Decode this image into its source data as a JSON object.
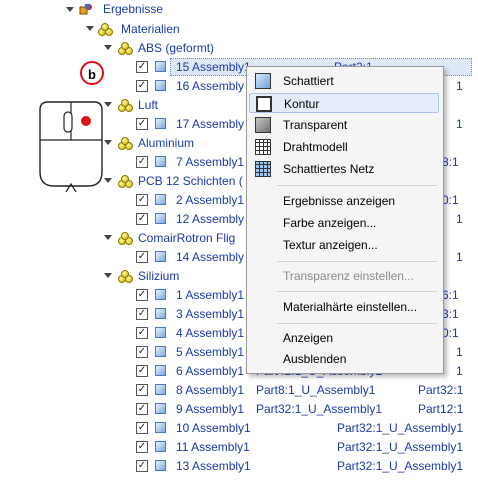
{
  "tree": {
    "root": "Ergebnisse",
    "materials": "Materialien",
    "groups": {
      "abs": "ABS (geformt)",
      "luft": "Luft",
      "aluminium": "Aluminium",
      "pcb": "PCB 12 Schichten (",
      "comair": "ComairRotron Flig",
      "silizium": "Silizium"
    },
    "rows": [
      {
        "name": "15 Assembly1",
        "c2": "",
        "c3": "Part2:1"
      },
      {
        "name": "16 Assembly",
        "c2": "",
        "c3": "1"
      },
      {
        "name": "17 Assembly",
        "c2": "",
        "c3": "1"
      },
      {
        "name": "7 Assembly1",
        "c2": "",
        "c3": "8:1"
      },
      {
        "name": "2 Assembly1",
        "c2": "",
        "c3": "0:1"
      },
      {
        "name": "12 Assembly",
        "c2": "",
        "c3": "1"
      },
      {
        "name": "14 Assembly",
        "c2": "",
        "c3": "1"
      },
      {
        "name": "1 Assembly1",
        "c2": "",
        "c3": "6:1"
      },
      {
        "name": "3 Assembly1",
        "c2": "",
        "c3": "3:1"
      },
      {
        "name": "4 Assembly1",
        "c2": "",
        "c3": "0:1"
      },
      {
        "name": "5 Assembly1",
        "c2": "",
        "c3": "1"
      },
      {
        "name": "6 Assembly1",
        "c2": "Part42:1_U_Assembly1",
        "c3": "1"
      },
      {
        "name": "8 Assembly1",
        "c2": "Part8:1_U_Assembly1",
        "c3": "Part32:1"
      },
      {
        "name": "9 Assembly1",
        "c2": "Part32:1_U_Assembly1",
        "c3": "Part12:1"
      },
      {
        "name": "10 Assembly1",
        "c2": "",
        "c3": "Part32:1_U_Assembly1"
      },
      {
        "name": "11 Assembly1",
        "c2": "",
        "c3": "Part32:1_U_Assembly1"
      },
      {
        "name": "13 Assembly1",
        "c2": "",
        "c3": "Part32:1_U_Assembly1"
      }
    ]
  },
  "badge": "b",
  "menu": {
    "items": [
      {
        "label": "Schattiert",
        "icon": "shaded-view-icon"
      },
      {
        "label": "Kontur",
        "icon": "contour-view-icon"
      },
      {
        "label": "Transparent",
        "icon": "transparent-view-icon"
      },
      {
        "label": "Drahtmodell",
        "icon": "wireframe-view-icon"
      },
      {
        "label": "Schattiertes Netz",
        "icon": "shaded-mesh-icon"
      },
      {
        "label": "Ergebnisse anzeigen"
      },
      {
        "label": "Farbe anzeigen..."
      },
      {
        "label": "Textur anzeigen..."
      },
      {
        "label": "Transparenz einstellen..."
      },
      {
        "label": "Materialhärte einstellen..."
      },
      {
        "label": "Anzeigen"
      },
      {
        "label": "Ausblenden"
      }
    ]
  },
  "colors": {
    "link": "#1a3aa8",
    "badge_border": "#dd1111",
    "mouse_button": "#e01010",
    "highlight": "#e5eefa"
  }
}
